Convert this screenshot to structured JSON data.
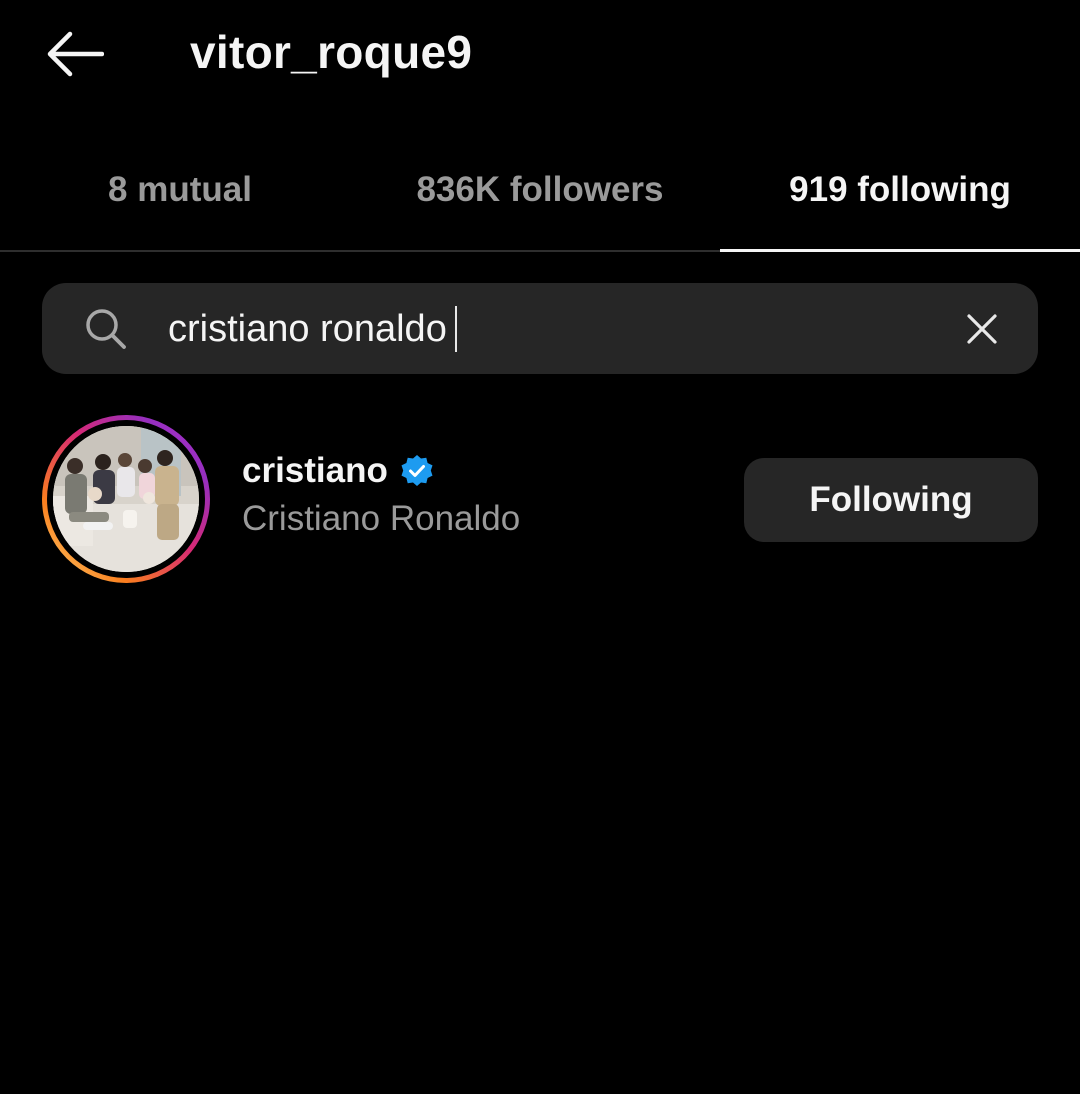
{
  "header": {
    "title": "vitor_roque9",
    "back_icon": "arrow-left-icon"
  },
  "tabs": [
    {
      "label": "8 mutual",
      "active": false
    },
    {
      "label": "836K followers",
      "active": false
    },
    {
      "label": "919 following",
      "active": true
    }
  ],
  "search": {
    "icon": "search-icon",
    "value": "cristiano ronaldo",
    "clear_icon": "close-icon"
  },
  "results": [
    {
      "username": "cristiano",
      "verified": true,
      "full_name": "Cristiano Ronaldo",
      "action_label": "Following",
      "has_story_ring": true
    }
  ],
  "colors": {
    "background": "#000000",
    "primary_text": "#f5f5f5",
    "secondary_text": "#9a9a9a",
    "surface": "#262626",
    "verified_badge": "#1d9bf0"
  }
}
